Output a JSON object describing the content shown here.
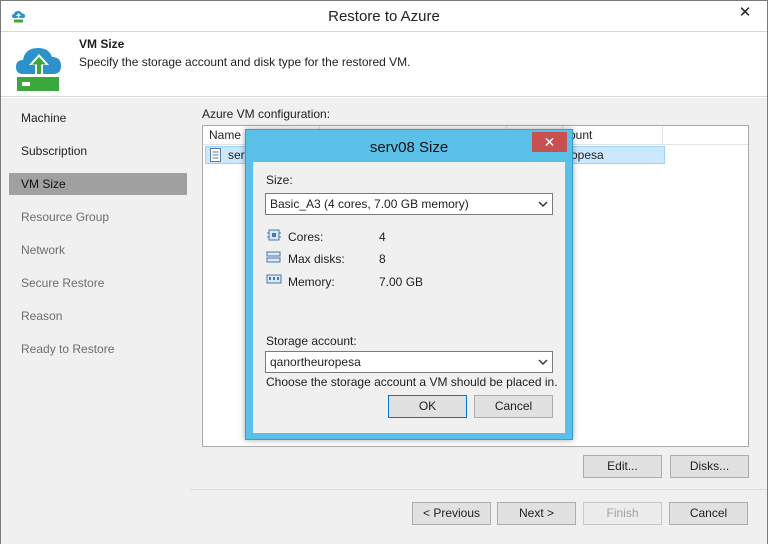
{
  "window": {
    "title": "Restore to Azure",
    "close_glyph": "✕"
  },
  "header": {
    "title": "VM Size",
    "subtitle": "Specify the storage account and disk type for the restored VM."
  },
  "sidebar": {
    "items": [
      {
        "label": "Machine",
        "state": "done"
      },
      {
        "label": "Subscription",
        "state": "done"
      },
      {
        "label": "VM Size",
        "state": "active"
      },
      {
        "label": "Resource Group",
        "state": "pending"
      },
      {
        "label": "Network",
        "state": "pending"
      },
      {
        "label": "Secure Restore",
        "state": "pending"
      },
      {
        "label": "Reason",
        "state": "pending"
      },
      {
        "label": "Ready to Restore",
        "state": "pending"
      }
    ]
  },
  "main": {
    "section_label": "Azure VM configuration:",
    "table": {
      "columns": [
        "Name",
        "",
        "",
        "ount"
      ],
      "rows": [
        {
          "name": "serv",
          "storage": "opesa"
        }
      ]
    },
    "edit_button": "Edit...",
    "disks_button": "Disks..."
  },
  "footer": {
    "previous": "< Previous",
    "next": "Next >",
    "finish": "Finish",
    "cancel": "Cancel"
  },
  "dialog": {
    "title": "serv08 Size",
    "close_glyph": "✕",
    "size_label": "Size:",
    "size_value": "Basic_A3 (4 cores, 7.00 GB memory)",
    "specs": [
      {
        "label": "Cores:",
        "value": "4",
        "icon": "cpu-icon"
      },
      {
        "label": "Max disks:",
        "value": "8",
        "icon": "disks-icon"
      },
      {
        "label": "Memory:",
        "value": "7.00 GB",
        "icon": "memory-icon"
      }
    ],
    "storage_label": "Storage account:",
    "storage_value": "qanortheuropesa",
    "storage_hint": "Choose the storage account a VM should be placed in.",
    "ok": "OK",
    "cancel": "Cancel"
  },
  "colors": {
    "dialog_frame": "#5bc0e8",
    "close_red": "#c75050",
    "selected_row": "#cce8ff",
    "active_nav": "#a0a0a0",
    "azure_green": "#3aa83a",
    "cloud_blue": "#2b93c9"
  }
}
